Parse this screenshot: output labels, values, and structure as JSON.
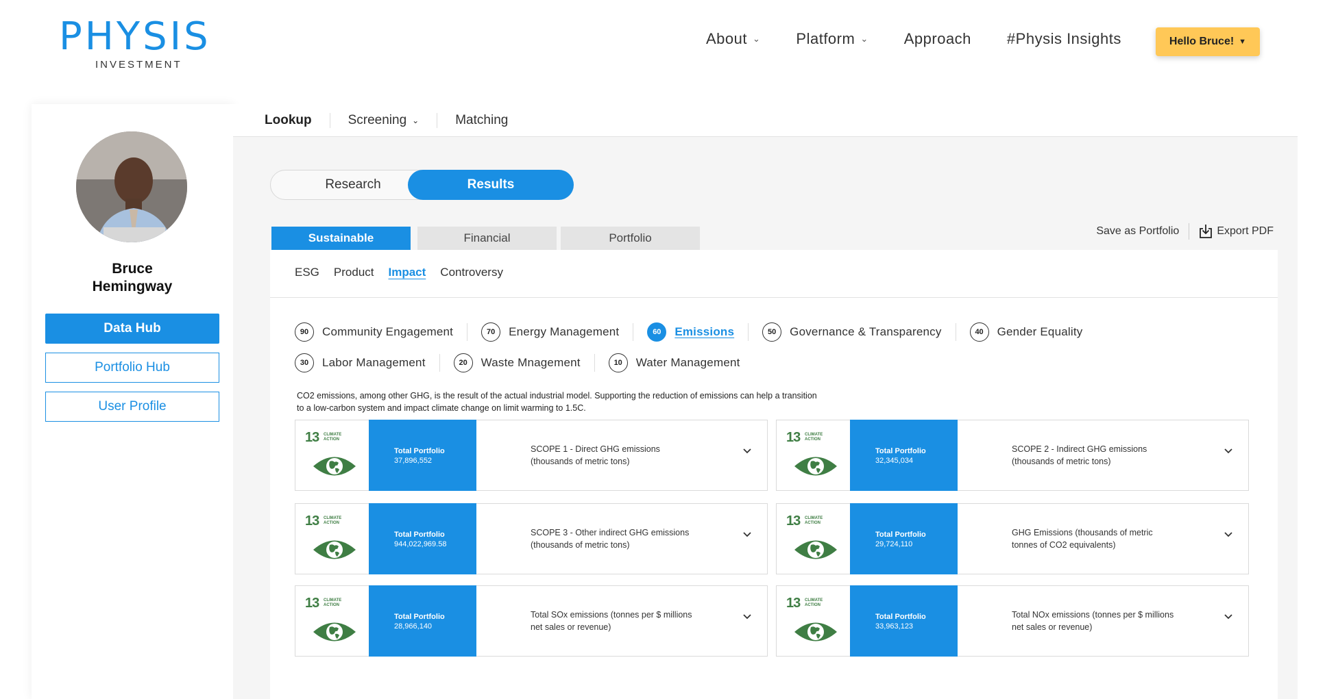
{
  "brand": {
    "logo_text": "PHYSIS",
    "logo_sub": "INVESTMENT",
    "color": "#1a8fe3"
  },
  "nav": {
    "items": [
      {
        "label": "About",
        "has_dropdown": true
      },
      {
        "label": "Platform",
        "has_dropdown": true
      },
      {
        "label": "Approach",
        "has_dropdown": false
      },
      {
        "label": "#Physis Insights",
        "has_dropdown": false
      }
    ],
    "user_button": "Hello Bruce!"
  },
  "sidebar": {
    "user_name_first": "Bruce",
    "user_name_last": "Hemingway",
    "buttons": [
      "Data Hub",
      "Portfolio Hub",
      "User Profile"
    ]
  },
  "topnav": {
    "items": [
      "Lookup",
      "Screening",
      "Matching"
    ],
    "active": "Lookup"
  },
  "toggle": {
    "research": "Research",
    "results": "Results",
    "active": "Results"
  },
  "category_tabs": {
    "items": [
      "Sustainable",
      "Financial",
      "Portfolio"
    ],
    "active": "Sustainable"
  },
  "actions": {
    "save": "Save as Portfolio",
    "export": "Export PDF"
  },
  "subtabs": {
    "items": [
      "ESG",
      "Product",
      "Impact",
      "Controversy"
    ],
    "active": "Impact"
  },
  "topics": [
    {
      "score": "90",
      "label": "Community Engagement"
    },
    {
      "score": "70",
      "label": "Energy Management"
    },
    {
      "score": "60",
      "label": "Emissions",
      "active": true
    },
    {
      "score": "50",
      "label": "Governance & Transparency"
    },
    {
      "score": "40",
      "label": "Gender Equality"
    },
    {
      "score": "30",
      "label": "Labor Management"
    },
    {
      "score": "20",
      "label": "Waste Mnagement"
    },
    {
      "score": "10",
      "label": "Water Management"
    }
  ],
  "description": "CO2 emissions, among other GHG, is the result of the actual industrial model. Supporting the reduction of emissions can help a transition to a low-carbon system and impact climate change on limit warming to 1.5C.",
  "sdg": {
    "number": "13",
    "text_1": "CLIMATE",
    "text_2": "ACTION",
    "color": "#3f7e44"
  },
  "cards": [
    {
      "total_label": "Total Portfolio",
      "total_value": "37,896,552",
      "metric": "SCOPE 1 - Direct GHG emissions (thousands of metric tons)"
    },
    {
      "total_label": "Total Portfolio",
      "total_value": "32,345,034",
      "metric": "SCOPE 2 - Indirect GHG emissions (thousands of metric tons)"
    },
    {
      "total_label": "Total Portfolio",
      "total_value": "944,022,969.58",
      "metric": "SCOPE 3 - Other indirect GHG emissions (thousands of metric tons)"
    },
    {
      "total_label": "Total Portfolio",
      "total_value": "29,724,110",
      "metric": "GHG Emissions (thousands of metric tonnes of CO2 equivalents)"
    },
    {
      "total_label": "Total Portfolio",
      "total_value": "28,966,140",
      "metric": "Total SOx emissions (tonnes per $ millions net sales or revenue)"
    },
    {
      "total_label": "Total Portfolio",
      "total_value": "33,963,123",
      "metric": "Total NOx emissions (tonnes per $ millions net sales or revenue)"
    }
  ]
}
